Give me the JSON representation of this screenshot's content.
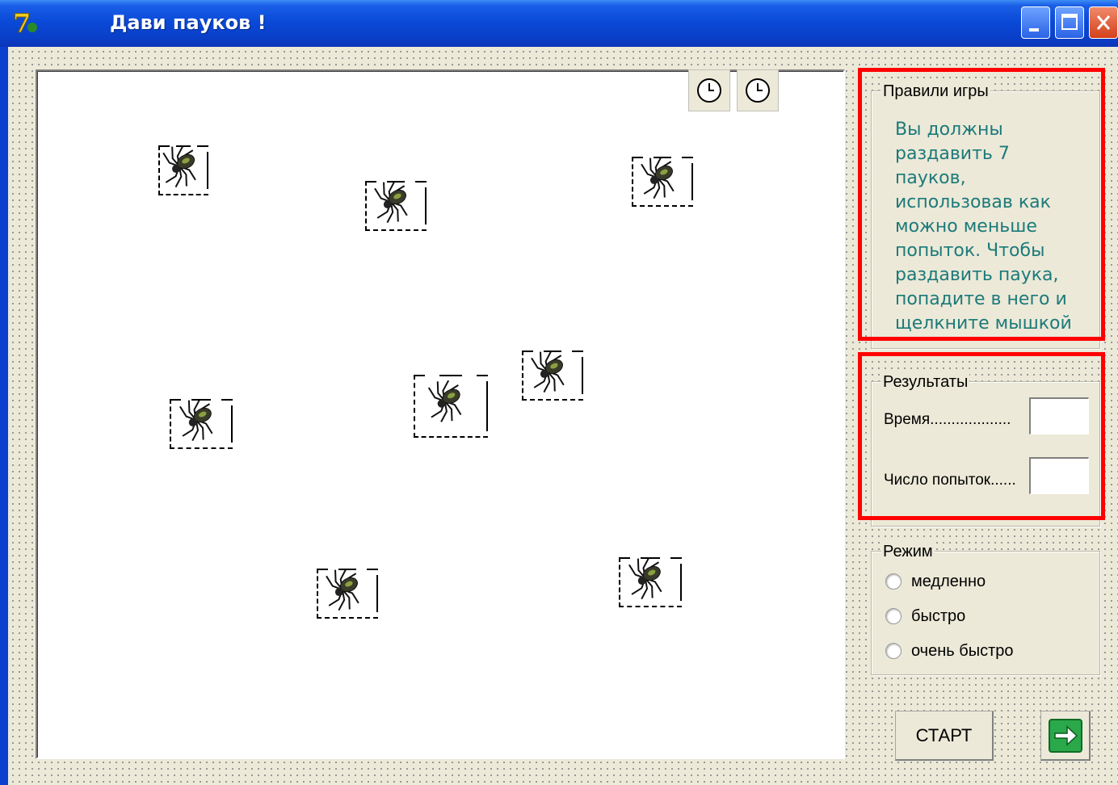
{
  "window": {
    "title": "Дави пауков !",
    "controls": [
      "minimize-icon",
      "maximize-icon",
      "close-icon"
    ]
  },
  "board": {
    "timers": [
      "clock-icon",
      "clock-icon"
    ],
    "spider_icon": "spider-icon",
    "spider_count_visible": 8
  },
  "rules": {
    "title": "Правили игры",
    "text": "Вы должны раздавить 7 пауков, использовав как можно меньше попыток. Чтобы раздавить паука, попадите в него и щелкните мышкой"
  },
  "results": {
    "title": "Результаты",
    "time_label": "Время...................",
    "time_value": "",
    "attempts_label": "Число попыток......",
    "attempts_value": ""
  },
  "mode": {
    "title": "Режим",
    "options": [
      "медленно",
      "быстро",
      "очень быстро"
    ]
  },
  "actions": {
    "start_label": "СТАРТ",
    "next_icon": "arrow-right-icon"
  },
  "colors": {
    "highlight": "#ff0000",
    "rules_text": "#1c7a7a",
    "titlebar": "#0a4ad8"
  }
}
